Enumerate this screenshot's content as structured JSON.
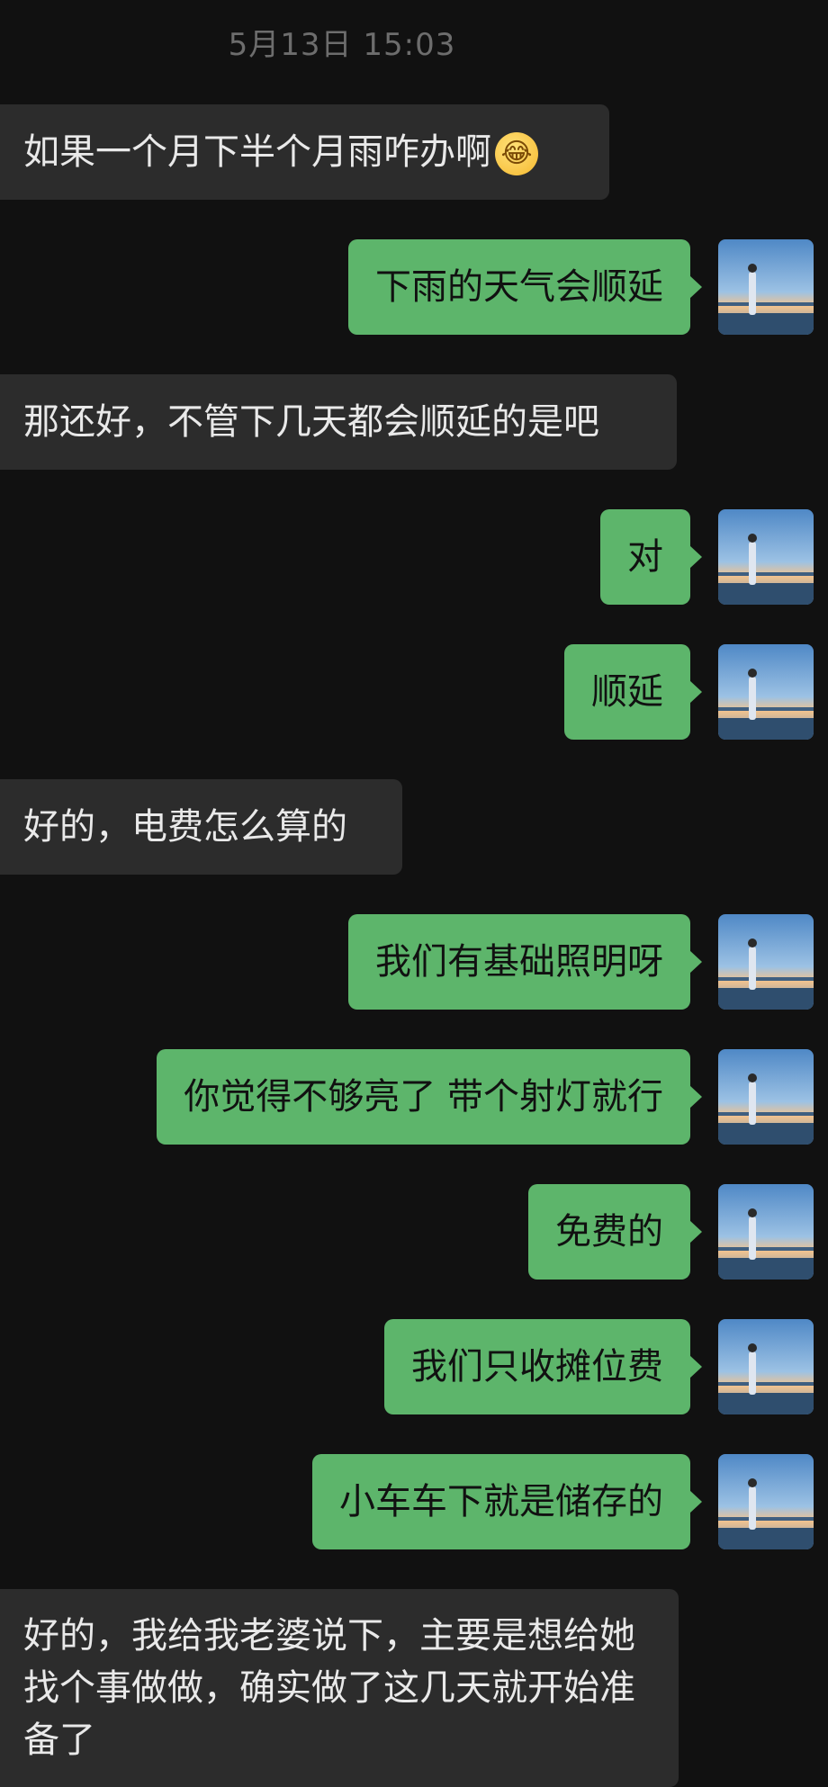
{
  "chat": {
    "timestamp": "5月13日 15:03",
    "messages": [
      {
        "side": "left",
        "text": "如果一个月下半个月雨咋办啊",
        "emoji": "crying-laughing-emoji"
      },
      {
        "side": "right",
        "text": "下雨的天气会顺延"
      },
      {
        "side": "left",
        "text": "那还好，不管下几天都会顺延的是吧"
      },
      {
        "side": "right",
        "text": "对"
      },
      {
        "side": "right",
        "text": "顺延"
      },
      {
        "side": "left",
        "text": "好的，电费怎么算的"
      },
      {
        "side": "right",
        "text": "我们有基础照明呀"
      },
      {
        "side": "right",
        "text": "你觉得不够亮了 带个射灯就行"
      },
      {
        "side": "right",
        "text": "免费的"
      },
      {
        "side": "right",
        "text": "我们只收摊位费"
      },
      {
        "side": "right",
        "text": "小车车下就是储存的"
      },
      {
        "side": "left",
        "text": "好的，我给我老婆说下，主要是想给她找个事做做，确实做了这几天就开始准备了"
      }
    ]
  },
  "emoji_glyph": "😂",
  "colors": {
    "background": "#111111",
    "bubble_left": "#2c2c2c",
    "bubble_right": "#5db56b",
    "text_left": "#e9e9e9",
    "text_right": "#111111"
  }
}
